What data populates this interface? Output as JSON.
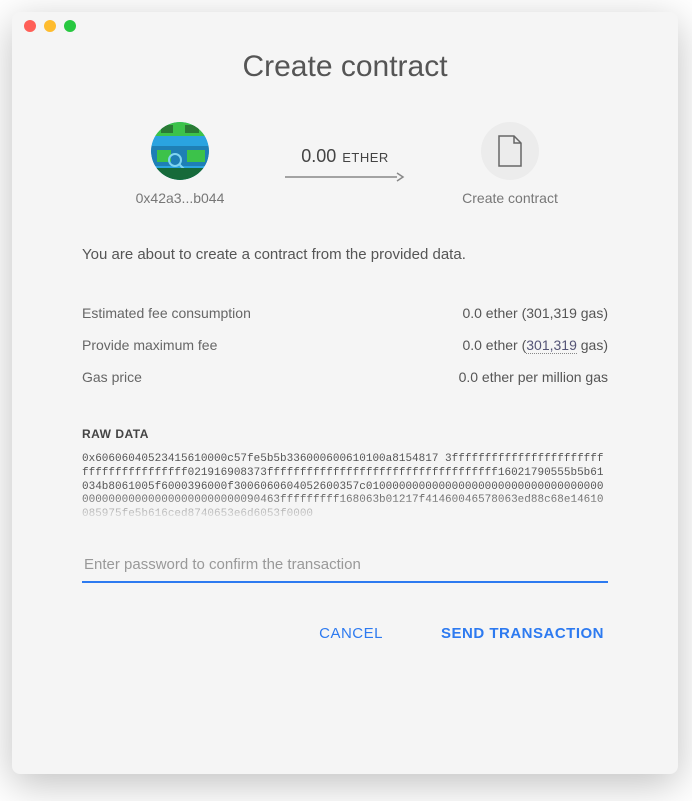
{
  "title": "Create contract",
  "from": {
    "address_short": "0x42a3...b044"
  },
  "to": {
    "label": "Create contract"
  },
  "transfer": {
    "amount": "0.00",
    "unit": "ETHER"
  },
  "about": "You are about to create a contract from the provided data.",
  "fees": {
    "estimated_label": "Estimated fee consumption",
    "estimated_value": "0.0 ether (301,319 gas)",
    "max_label": "Provide maximum fee",
    "max_value_prefix": "0.0 ether (",
    "max_gas": "301,319",
    "max_value_suffix": " gas)",
    "price_label": "Gas price",
    "price_value": "0.0 ether per million gas"
  },
  "raw": {
    "label": "RAW DATA",
    "data": "0x60606040523415610000c57fe5b5b336000600610100a8154817 3fffffffffffffffffffffffffffffffffffffff021916908373fffffffffffffffffffffffffffffffffff16021790555b5b61034b8061005f6000396000f3006060604052600357c010000000000000000000000000000000000000000000000000000000000090463fffffffff168063b01217f41460046578063ed88c68e14610085975fe5b616ced8740653e6d6053f0000"
  },
  "password": {
    "placeholder": "Enter password to confirm the transaction"
  },
  "actions": {
    "cancel": "CANCEL",
    "send": "SEND TRANSACTION"
  }
}
